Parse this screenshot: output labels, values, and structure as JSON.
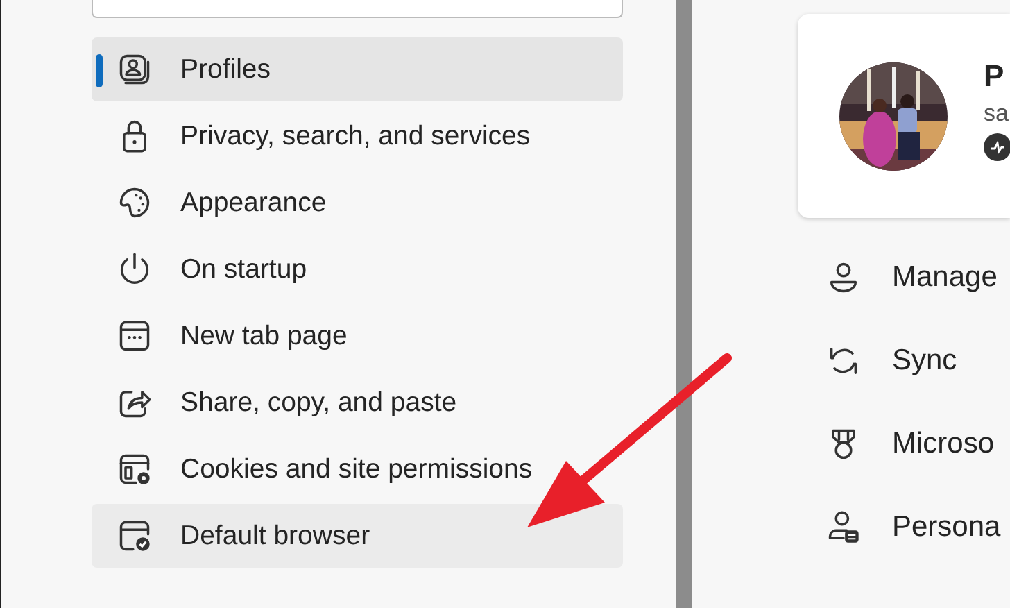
{
  "sidebar": {
    "items": [
      {
        "label": "Profiles",
        "selected": true,
        "hovered": false
      },
      {
        "label": "Privacy, search, and services",
        "selected": false,
        "hovered": false
      },
      {
        "label": "Appearance",
        "selected": false,
        "hovered": false
      },
      {
        "label": "On startup",
        "selected": false,
        "hovered": false
      },
      {
        "label": "New tab page",
        "selected": false,
        "hovered": false
      },
      {
        "label": "Share, copy, and paste",
        "selected": false,
        "hovered": false
      },
      {
        "label": "Cookies and site permissions",
        "selected": false,
        "hovered": false
      },
      {
        "label": "Default browser",
        "selected": false,
        "hovered": true
      }
    ]
  },
  "profile_card": {
    "name": "P",
    "email": "sa"
  },
  "profile_menu": [
    {
      "label": "Manage"
    },
    {
      "label": "Sync"
    },
    {
      "label": "Microso"
    },
    {
      "label": "Persona"
    }
  ]
}
